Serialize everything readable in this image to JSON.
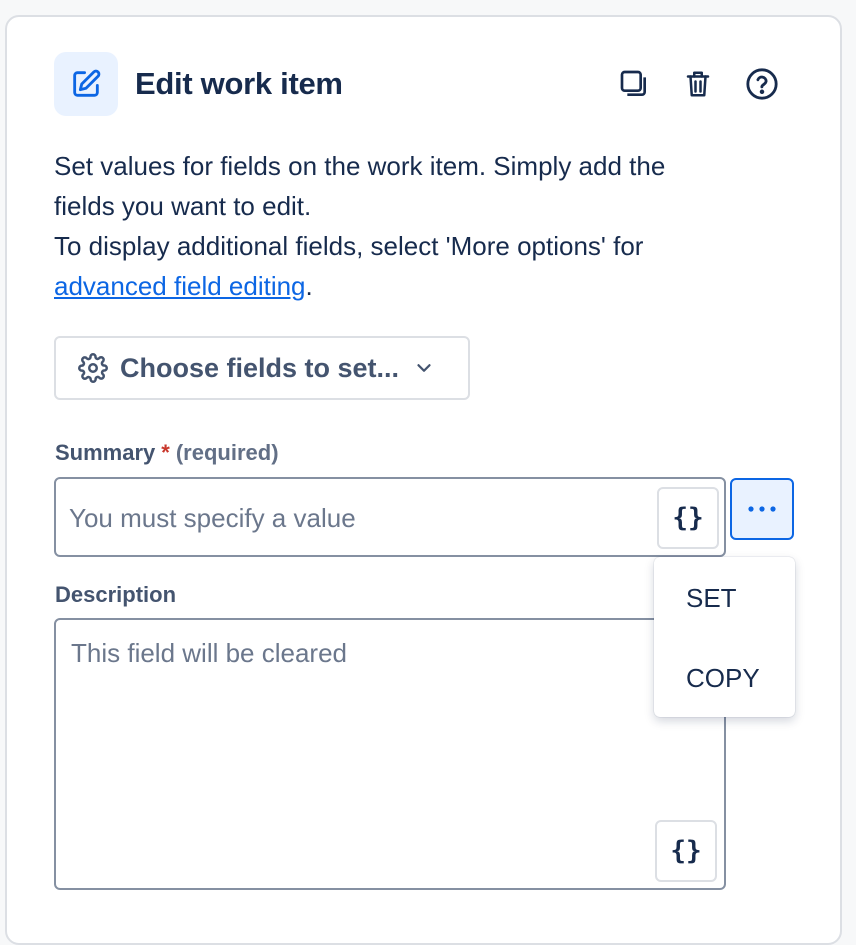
{
  "header": {
    "title": "Edit work item",
    "icon": "edit-icon",
    "actions": [
      {
        "name": "duplicate-icon"
      },
      {
        "name": "trash-icon"
      },
      {
        "name": "help-icon"
      }
    ]
  },
  "description": {
    "line1": "Set values for fields on the work item. Simply add the",
    "line2": "fields you want to edit.",
    "line3": "To display additional fields, select 'More options' for",
    "link_text": "advanced field editing",
    "link_suffix": "."
  },
  "choose_fields": {
    "label": "Choose fields to set...",
    "icon": "gear-icon"
  },
  "summary": {
    "label": "Summary",
    "required_marker": "*",
    "required_note": "(required)",
    "placeholder": "You must specify a value",
    "value": "",
    "brace_label": "{}"
  },
  "description_field": {
    "label": "Description",
    "placeholder": "This field will be cleared",
    "value": "",
    "brace_label": "{}"
  },
  "more_menu": {
    "items": [
      "SET",
      "COPY"
    ]
  },
  "colors": {
    "accent": "#0c66e4",
    "accent_bg": "#e9f2ff",
    "required": "#c9372c",
    "text": "#172b4d",
    "subtle_text": "#44546f"
  }
}
